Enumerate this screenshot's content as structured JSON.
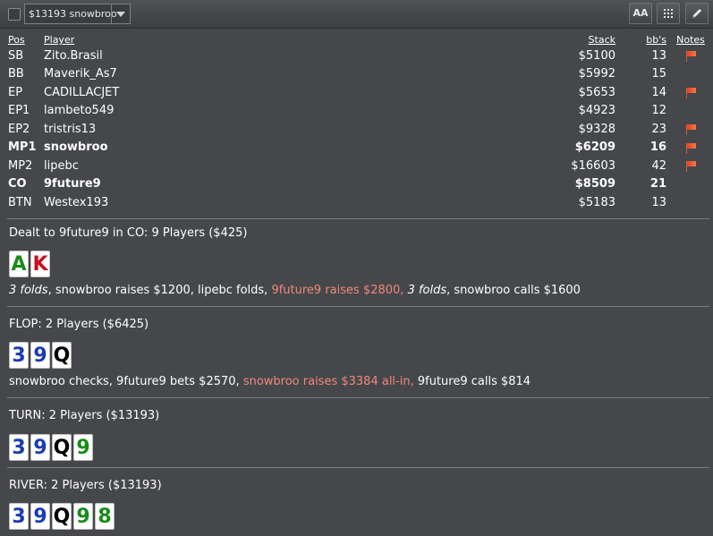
{
  "toolbar": {
    "hand_select_value": "$13193 snowbroo",
    "font_button_label": "AA"
  },
  "table": {
    "headers": {
      "pos": "Pos",
      "player": "Player",
      "stack": "Stack",
      "bbs": "bb's",
      "notes": "Notes"
    },
    "rows": [
      {
        "pos": "SB",
        "player": "Zito.Brasil",
        "stack": "$5100",
        "bbs": "13",
        "flag": true,
        "bold": false
      },
      {
        "pos": "BB",
        "player": "Maverik_As7",
        "stack": "$5992",
        "bbs": "15",
        "flag": false,
        "bold": false
      },
      {
        "pos": "EP",
        "player": "CADILLACJET",
        "stack": "$5653",
        "bbs": "14",
        "flag": true,
        "bold": false
      },
      {
        "pos": "EP1",
        "player": "lambeto549",
        "stack": "$4923",
        "bbs": "12",
        "flag": false,
        "bold": false
      },
      {
        "pos": "EP2",
        "player": "tristris13",
        "stack": "$9328",
        "bbs": "23",
        "flag": true,
        "bold": false
      },
      {
        "pos": "MP1",
        "player": "snowbroo",
        "stack": "$6209",
        "bbs": "16",
        "flag": true,
        "bold": true
      },
      {
        "pos": "MP2",
        "player": "lipebc",
        "stack": "$16603",
        "bbs": "42",
        "flag": true,
        "bold": false
      },
      {
        "pos": "CO",
        "player": "9future9",
        "stack": "$8509",
        "bbs": "21",
        "flag": false,
        "bold": true
      },
      {
        "pos": "BTN",
        "player": "Westex193",
        "stack": "$5183",
        "bbs": "13",
        "flag": false,
        "bold": false
      }
    ]
  },
  "preflop": {
    "title": "Dealt to 9future9 in CO: 9 Players ($425)",
    "cards": [
      {
        "rank": "A",
        "suit": "c"
      },
      {
        "rank": "K",
        "suit": "h"
      }
    ],
    "actions": [
      {
        "text": "3 folds",
        "style": "it"
      },
      {
        "text": ", snowbroo raises $1200, lipebc folds, ",
        "style": ""
      },
      {
        "text": "9future9 raises $2800, ",
        "style": "hero"
      },
      {
        "text": "3 folds",
        "style": "it"
      },
      {
        "text": ", snowbroo calls $1600",
        "style": ""
      }
    ]
  },
  "flop": {
    "title": "FLOP: 2 Players ($6425)",
    "cards": [
      {
        "rank": "3",
        "suit": "d"
      },
      {
        "rank": "9",
        "suit": "d"
      },
      {
        "rank": "Q",
        "suit": "s"
      }
    ],
    "actions": [
      {
        "text": "snowbroo checks, 9future9 bets $2570, ",
        "style": ""
      },
      {
        "text": "snowbroo raises $3384 all-in, ",
        "style": "hero"
      },
      {
        "text": "9future9 calls $814",
        "style": ""
      }
    ]
  },
  "turn": {
    "title": "TURN: 2 Players ($13193)",
    "cards": [
      {
        "rank": "3",
        "suit": "d"
      },
      {
        "rank": "9",
        "suit": "d"
      },
      {
        "rank": "Q",
        "suit": "s"
      },
      {
        "rank": "9",
        "suit": "c"
      }
    ]
  },
  "river": {
    "title": "RIVER: 2 Players ($13193)",
    "cards": [
      {
        "rank": "3",
        "suit": "d"
      },
      {
        "rank": "9",
        "suit": "d"
      },
      {
        "rank": "Q",
        "suit": "s"
      },
      {
        "rank": "9",
        "suit": "c"
      },
      {
        "rank": "8",
        "suit": "c"
      }
    ]
  }
}
